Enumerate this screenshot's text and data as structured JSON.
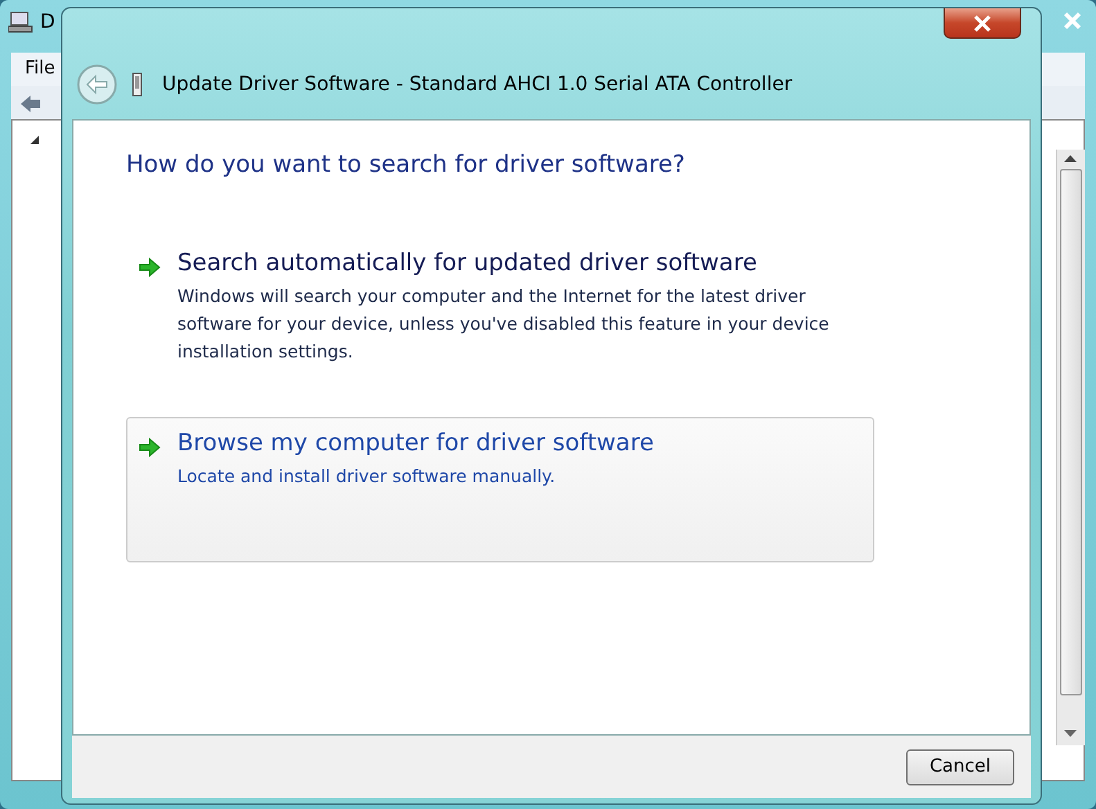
{
  "background_window": {
    "title": "D",
    "menu": [
      "File"
    ]
  },
  "dialog": {
    "title": "Update Driver Software - Standard AHCI 1.0 Serial ATA Controller",
    "heading": "How do you want to search for driver software?",
    "options": [
      {
        "title": "Search automatically for updated driver software",
        "description": "Windows will search your computer and the Internet for the latest driver software for your device, unless you've disabled this feature in your device installation settings.",
        "selected": false
      },
      {
        "title": "Browse my computer for driver software",
        "description": "Locate and install driver software manually.",
        "selected": true
      }
    ],
    "buttons": [
      "Cancel"
    ]
  }
}
